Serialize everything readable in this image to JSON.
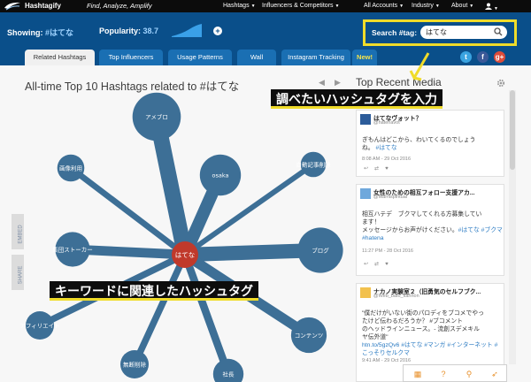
{
  "nav": {
    "brand": "Hashtagify",
    "tagline": "Find, Analyze, Amplify",
    "items": [
      {
        "label": "Hashtags"
      },
      {
        "label": "Influencers & Competitors"
      },
      {
        "label": "All Accounts"
      },
      {
        "label": "Industry"
      },
      {
        "label": "About"
      }
    ]
  },
  "header": {
    "showing_label": "Showing:",
    "showing_value": "#はてな",
    "popularity_label": "Popularity:",
    "popularity_value": "38.7",
    "search_label": "Search #tag:",
    "search_value": "はてな"
  },
  "tabs": [
    {
      "label": "Related Hashtags",
      "active": true
    },
    {
      "label": "Top Influencers"
    },
    {
      "label": "Usage Patterns"
    },
    {
      "label": "Wall"
    },
    {
      "label": "Instagram Tracking"
    },
    {
      "label": "New!"
    }
  ],
  "social": [
    "t",
    "f",
    "g+"
  ],
  "chart_title": "All-time Top 10 Hashtags related to #はてな",
  "side_tabs": [
    "EMBED",
    "SHARE"
  ],
  "callouts": {
    "search": "調べたいハッシュタグを入力",
    "related": "キーワードに関連したハッシュタグ"
  },
  "recent": {
    "title": "Top Recent Media",
    "pager_prev": "◀",
    "pager_next": "▶"
  },
  "tweets": [
    {
      "name": "はてなヴォット？",
      "handle": "@hatenavot",
      "body_lines": [
        "ぎもんはどこから、わいてくるのでしょう",
        "ね。"
      ],
      "hashtag": "#はてな",
      "time": "8:08 AM - 29 Oct 2016"
    },
    {
      "name": "女性のための相互フォロー支援アカ...",
      "handle": "@Mamispiritual",
      "body_lines": [
        "相互ハテデ　ブクマしてくれる方募集してい",
        "ます！",
        "メッセージからお声がけください。"
      ],
      "hashtag": "#はてな #ブクマ #hatena",
      "time": "11:27 PM - 28 Oct 2016"
    },
    {
      "name": "ナカノ実験室２（旧勇気のセルフブク...",
      "handle": "@Web_bato_kannon",
      "body_lines": [
        "\"僕だけがいない街のパロディをブコメでやっ",
        "たけど伝わるだろうか？ #ブコメント",
        "のヘッドラインニュース。- 流創スデメキル",
        "ヤ伝外道\""
      ],
      "hashtag": "htn.to/5gzQv6 #はてな #マンガ #インターネット #こっそりセルクマ",
      "time": "9:41 AM - 29 Oct 2016"
    }
  ],
  "chart_data": {
    "type": "network",
    "center": "はてな",
    "nodes": [
      {
        "label": "アメブロ",
        "weight": 0.72
      },
      {
        "label": "osaka",
        "weight": 0.55
      },
      {
        "label": "自動記事削除",
        "weight": 0.18
      },
      {
        "label": "ブログ",
        "weight": 0.65
      },
      {
        "label": "コンテンツ",
        "weight": 0.42
      },
      {
        "label": "社長",
        "weight": 0.3
      },
      {
        "label": "無断削除",
        "weight": 0.25
      },
      {
        "label": "アフィリエイト",
        "weight": 0.25
      },
      {
        "label": "集団ストーカー",
        "weight": 0.4
      },
      {
        "label": "画像利用",
        "weight": 0.22
      }
    ]
  },
  "colors": {
    "header": "#0a4f8a",
    "node": "#3d6f96",
    "center": "#c0392b",
    "callout_underline": "#f0dc2a"
  }
}
